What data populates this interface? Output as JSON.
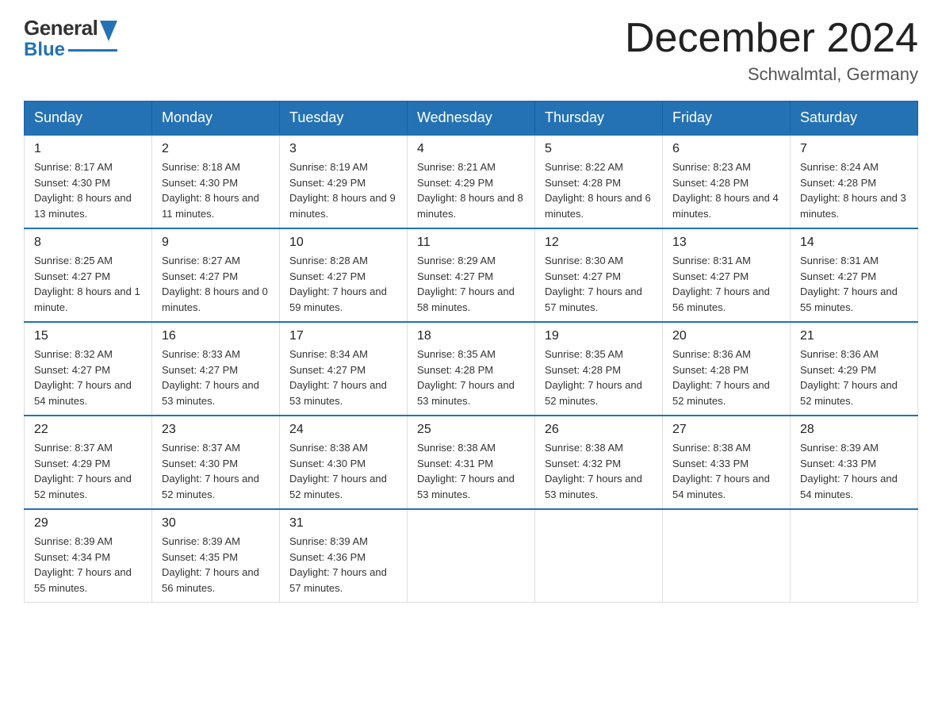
{
  "header": {
    "logo_general": "General",
    "logo_blue": "Blue",
    "month_title": "December 2024",
    "location": "Schwalmtal, Germany"
  },
  "days_of_week": [
    "Sunday",
    "Monday",
    "Tuesday",
    "Wednesday",
    "Thursday",
    "Friday",
    "Saturday"
  ],
  "weeks": [
    [
      {
        "day": "1",
        "sunrise": "Sunrise: 8:17 AM",
        "sunset": "Sunset: 4:30 PM",
        "daylight": "Daylight: 8 hours and 13 minutes."
      },
      {
        "day": "2",
        "sunrise": "Sunrise: 8:18 AM",
        "sunset": "Sunset: 4:30 PM",
        "daylight": "Daylight: 8 hours and 11 minutes."
      },
      {
        "day": "3",
        "sunrise": "Sunrise: 8:19 AM",
        "sunset": "Sunset: 4:29 PM",
        "daylight": "Daylight: 8 hours and 9 minutes."
      },
      {
        "day": "4",
        "sunrise": "Sunrise: 8:21 AM",
        "sunset": "Sunset: 4:29 PM",
        "daylight": "Daylight: 8 hours and 8 minutes."
      },
      {
        "day": "5",
        "sunrise": "Sunrise: 8:22 AM",
        "sunset": "Sunset: 4:28 PM",
        "daylight": "Daylight: 8 hours and 6 minutes."
      },
      {
        "day": "6",
        "sunrise": "Sunrise: 8:23 AM",
        "sunset": "Sunset: 4:28 PM",
        "daylight": "Daylight: 8 hours and 4 minutes."
      },
      {
        "day": "7",
        "sunrise": "Sunrise: 8:24 AM",
        "sunset": "Sunset: 4:28 PM",
        "daylight": "Daylight: 8 hours and 3 minutes."
      }
    ],
    [
      {
        "day": "8",
        "sunrise": "Sunrise: 8:25 AM",
        "sunset": "Sunset: 4:27 PM",
        "daylight": "Daylight: 8 hours and 1 minute."
      },
      {
        "day": "9",
        "sunrise": "Sunrise: 8:27 AM",
        "sunset": "Sunset: 4:27 PM",
        "daylight": "Daylight: 8 hours and 0 minutes."
      },
      {
        "day": "10",
        "sunrise": "Sunrise: 8:28 AM",
        "sunset": "Sunset: 4:27 PM",
        "daylight": "Daylight: 7 hours and 59 minutes."
      },
      {
        "day": "11",
        "sunrise": "Sunrise: 8:29 AM",
        "sunset": "Sunset: 4:27 PM",
        "daylight": "Daylight: 7 hours and 58 minutes."
      },
      {
        "day": "12",
        "sunrise": "Sunrise: 8:30 AM",
        "sunset": "Sunset: 4:27 PM",
        "daylight": "Daylight: 7 hours and 57 minutes."
      },
      {
        "day": "13",
        "sunrise": "Sunrise: 8:31 AM",
        "sunset": "Sunset: 4:27 PM",
        "daylight": "Daylight: 7 hours and 56 minutes."
      },
      {
        "day": "14",
        "sunrise": "Sunrise: 8:31 AM",
        "sunset": "Sunset: 4:27 PM",
        "daylight": "Daylight: 7 hours and 55 minutes."
      }
    ],
    [
      {
        "day": "15",
        "sunrise": "Sunrise: 8:32 AM",
        "sunset": "Sunset: 4:27 PM",
        "daylight": "Daylight: 7 hours and 54 minutes."
      },
      {
        "day": "16",
        "sunrise": "Sunrise: 8:33 AM",
        "sunset": "Sunset: 4:27 PM",
        "daylight": "Daylight: 7 hours and 53 minutes."
      },
      {
        "day": "17",
        "sunrise": "Sunrise: 8:34 AM",
        "sunset": "Sunset: 4:27 PM",
        "daylight": "Daylight: 7 hours and 53 minutes."
      },
      {
        "day": "18",
        "sunrise": "Sunrise: 8:35 AM",
        "sunset": "Sunset: 4:28 PM",
        "daylight": "Daylight: 7 hours and 53 minutes."
      },
      {
        "day": "19",
        "sunrise": "Sunrise: 8:35 AM",
        "sunset": "Sunset: 4:28 PM",
        "daylight": "Daylight: 7 hours and 52 minutes."
      },
      {
        "day": "20",
        "sunrise": "Sunrise: 8:36 AM",
        "sunset": "Sunset: 4:28 PM",
        "daylight": "Daylight: 7 hours and 52 minutes."
      },
      {
        "day": "21",
        "sunrise": "Sunrise: 8:36 AM",
        "sunset": "Sunset: 4:29 PM",
        "daylight": "Daylight: 7 hours and 52 minutes."
      }
    ],
    [
      {
        "day": "22",
        "sunrise": "Sunrise: 8:37 AM",
        "sunset": "Sunset: 4:29 PM",
        "daylight": "Daylight: 7 hours and 52 minutes."
      },
      {
        "day": "23",
        "sunrise": "Sunrise: 8:37 AM",
        "sunset": "Sunset: 4:30 PM",
        "daylight": "Daylight: 7 hours and 52 minutes."
      },
      {
        "day": "24",
        "sunrise": "Sunrise: 8:38 AM",
        "sunset": "Sunset: 4:30 PM",
        "daylight": "Daylight: 7 hours and 52 minutes."
      },
      {
        "day": "25",
        "sunrise": "Sunrise: 8:38 AM",
        "sunset": "Sunset: 4:31 PM",
        "daylight": "Daylight: 7 hours and 53 minutes."
      },
      {
        "day": "26",
        "sunrise": "Sunrise: 8:38 AM",
        "sunset": "Sunset: 4:32 PM",
        "daylight": "Daylight: 7 hours and 53 minutes."
      },
      {
        "day": "27",
        "sunrise": "Sunrise: 8:38 AM",
        "sunset": "Sunset: 4:33 PM",
        "daylight": "Daylight: 7 hours and 54 minutes."
      },
      {
        "day": "28",
        "sunrise": "Sunrise: 8:39 AM",
        "sunset": "Sunset: 4:33 PM",
        "daylight": "Daylight: 7 hours and 54 minutes."
      }
    ],
    [
      {
        "day": "29",
        "sunrise": "Sunrise: 8:39 AM",
        "sunset": "Sunset: 4:34 PM",
        "daylight": "Daylight: 7 hours and 55 minutes."
      },
      {
        "day": "30",
        "sunrise": "Sunrise: 8:39 AM",
        "sunset": "Sunset: 4:35 PM",
        "daylight": "Daylight: 7 hours and 56 minutes."
      },
      {
        "day": "31",
        "sunrise": "Sunrise: 8:39 AM",
        "sunset": "Sunset: 4:36 PM",
        "daylight": "Daylight: 7 hours and 57 minutes."
      },
      null,
      null,
      null,
      null
    ]
  ]
}
